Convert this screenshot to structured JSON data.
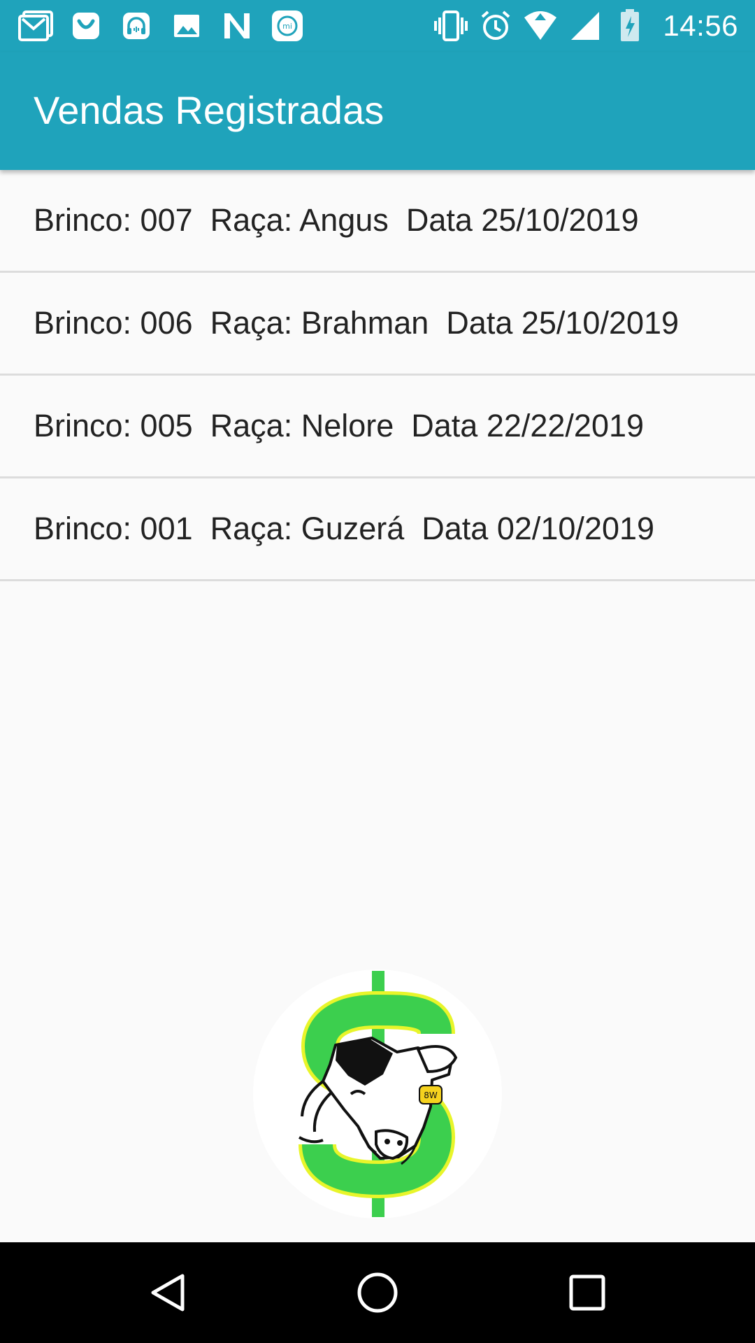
{
  "status_bar": {
    "time": "14:56",
    "left_icons": [
      "gmail-icon",
      "shopping-bag-icon",
      "headphones-icon",
      "image-icon",
      "n-logo-icon",
      "mi-icon"
    ],
    "right_icons": [
      "vibrate-icon",
      "alarm-icon",
      "wifi-icon",
      "signal-icon",
      "battery-charging-icon"
    ]
  },
  "app_bar": {
    "title": "Vendas Registradas"
  },
  "sales": [
    {
      "text": "Brinco: 007  Raça: Angus  Data 25/10/2019"
    },
    {
      "text": "Brinco: 006  Raça: Brahman  Data 25/10/2019"
    },
    {
      "text": "Brinco: 005  Raça: Nelore  Data 22/22/2019"
    },
    {
      "text": "Brinco: 001  Raça: Guzerá  Data 02/10/2019"
    }
  ],
  "logo": {
    "tag_text": "8W"
  },
  "nav_bar": {
    "buttons": [
      "back-icon",
      "home-icon",
      "recents-icon"
    ]
  },
  "colors": {
    "primary": "#1fa3bb",
    "logo_green": "#3ccf4e",
    "divider": "#dcdcdc",
    "nav_background": "#000000"
  }
}
